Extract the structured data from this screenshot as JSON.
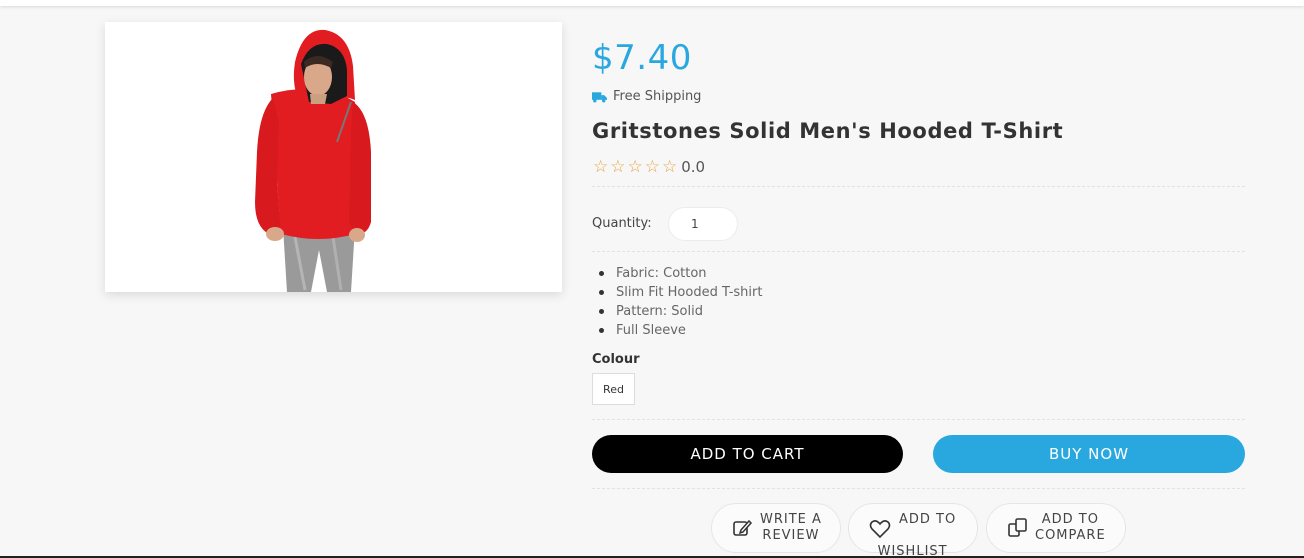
{
  "product": {
    "price": "$7.40",
    "shipping": "Free Shipping",
    "title": "Gritstones Solid Men's Hooded T-Shirt",
    "rating": "0.0",
    "stars": [
      "☆",
      "☆",
      "☆",
      "☆",
      "☆"
    ],
    "image_icon": "product-photo-red-hooded-tshirt"
  },
  "quantity": {
    "label": "Quantity:",
    "value": "1"
  },
  "features": [
    "Fabric: Cotton",
    "Slim Fit Hooded T-shirt",
    "Pattern: Solid",
    "Full Sleeve"
  ],
  "colour": {
    "label": "Colour",
    "selected": "Red"
  },
  "actions": {
    "add_to_cart": "ADD TO CART",
    "buy_now": "BUY NOW",
    "write_review_1": "WRITE A",
    "write_review_2": "REVIEW",
    "wishlist_1": "ADD TO",
    "wishlist_2": "WISHLIST",
    "compare_1": "ADD TO",
    "compare_2": "COMPARE"
  },
  "colors": {
    "accent": "#29a8e0",
    "cart_button": "#000000",
    "star": "#e8a445"
  }
}
